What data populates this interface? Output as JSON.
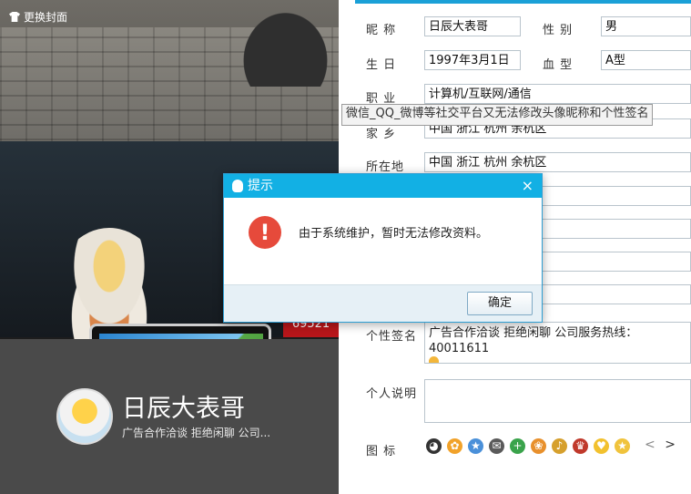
{
  "cover": {
    "change_cover_label": "更换封面",
    "badge_number": "69521"
  },
  "profile": {
    "name": "日辰大表哥",
    "signature_short": "广告合作洽谈 拒绝闲聊 公司..."
  },
  "form": {
    "nickname": {
      "label": "昵 称",
      "value": "日辰大表哥"
    },
    "gender": {
      "label": "性 别",
      "value": "男"
    },
    "birthday": {
      "label": "生 日",
      "value": "1997年3月1日"
    },
    "blood": {
      "label": "血 型",
      "value": "A型"
    },
    "job": {
      "label": "职 业",
      "value": "计算机/互联网/通信"
    },
    "hometown": {
      "label": "家 乡",
      "value": "中国  浙江  杭州  余杭区"
    },
    "location": {
      "label": "所在地",
      "value": "中国  浙江  杭州  余杭区"
    },
    "signature": {
      "label": "个性签名",
      "value": "广告合作洽谈 拒绝闲聊 公司服务热线：40011611"
    },
    "description": {
      "label": "个人说明",
      "value": ""
    },
    "icons": {
      "label": "图 标"
    },
    "nav_prev": "<",
    "nav_next": ">"
  },
  "tooltip": "微信_QQ_微博等社交平台又无法修改头像昵称和个性签名",
  "dialog": {
    "title": "提示",
    "close": "×",
    "message": "由于系统维护，暂时无法修改资料。",
    "ok_label": "确定",
    "warn_glyph": "!"
  },
  "colors": {
    "accent": "#12b0e4",
    "warn": "#e64a3b",
    "badge": "#b8161a",
    "panel": "#4a4a4a"
  }
}
